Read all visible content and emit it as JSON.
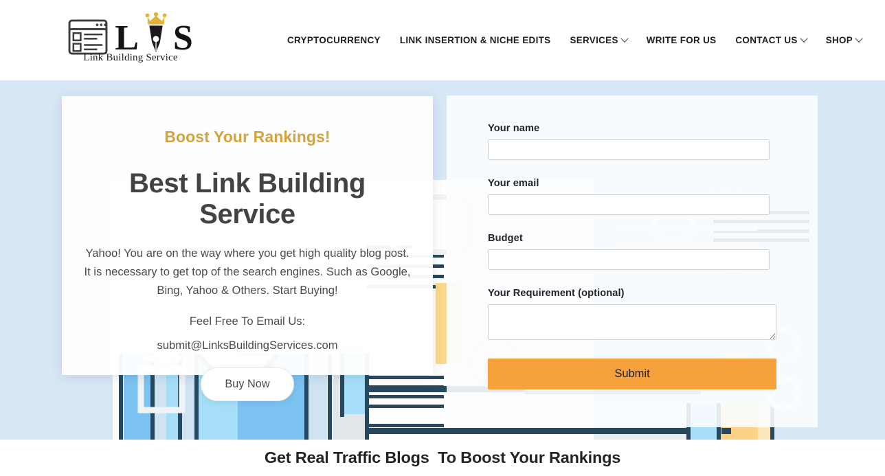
{
  "header": {
    "logo": {
      "letter_left": "L",
      "letter_right": "S",
      "caption": "Link Building Service",
      "browser_icon": "browser-window-icon",
      "pen_icon": "pen-nib-crown-icon"
    },
    "nav": [
      {
        "label": "CRYPTOCURRENCY",
        "has_dropdown": false
      },
      {
        "label": "LINK INSERTION & NICHE EDITS",
        "has_dropdown": false
      },
      {
        "label": "SERVICES",
        "has_dropdown": true
      },
      {
        "label": "WRITE FOR US",
        "has_dropdown": false
      },
      {
        "label": "CONTACT US",
        "has_dropdown": true
      },
      {
        "label": "SHOP",
        "has_dropdown": true
      }
    ]
  },
  "hero": {
    "promo": {
      "kicker": "Boost Your Rankings!",
      "title": "Best Link Building Service",
      "body": "Yahoo! You are on the way where you get high quality blog post. It is necessary to get top of the search engines. Such as Google, Bing, Yahoo & Others. Start Buying!",
      "email_label": "Feel Free To Email Us:",
      "email": "submit@LinksBuildingServices.com",
      "cta": "Buy Now"
    },
    "form": {
      "name_label": "Your name",
      "name_value": "",
      "name_placeholder": "",
      "email_label": "Your email",
      "email_value": "",
      "email_placeholder": "",
      "budget_label": "Budget",
      "budget_value": "",
      "budget_placeholder": "",
      "requirement_label": "Your Requirement (optional)",
      "requirement_value": "",
      "requirement_placeholder": "",
      "submit_label": "Submit"
    }
  },
  "bottom": {
    "heading": "Get Real Traffic Blogs  To Boost Your Rankings"
  },
  "colors": {
    "accent_gold": "#d2a33f",
    "submit_orange": "#f6a23c",
    "hero_bg": "#d8e7f5",
    "illu_navy": "#27495f",
    "illu_blue_mid": "#7dc2f0",
    "illu_blue_light": "#a6def8",
    "illu_yellow": "#fad98b",
    "text_dark": "#434343"
  }
}
